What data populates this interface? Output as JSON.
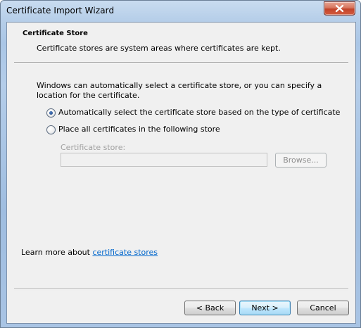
{
  "window": {
    "title": "Certificate Import Wizard"
  },
  "header": {
    "title": "Certificate Store",
    "subtitle": "Certificate stores are system areas where certificates are kept."
  },
  "body": {
    "intro": "Windows can automatically select a certificate store, or you can specify a location for the certificate.",
    "options": [
      {
        "label": "Automatically select the certificate store based on the type of certificate",
        "selected": true
      },
      {
        "label": "Place all certificates in the following store",
        "selected": false
      }
    ],
    "store_label": "Certificate store:",
    "store_value": "",
    "browse_label": "Browse..."
  },
  "footer": {
    "learn_prefix": "Learn more about ",
    "learn_link": "certificate stores",
    "back_label": "< Back",
    "next_label": "Next >",
    "cancel_label": "Cancel"
  },
  "icons": {
    "close": "close-icon"
  },
  "colors": {
    "link": "#0066cc",
    "close_button": "#c2442a",
    "default_button_border": "#3c7fb1"
  }
}
